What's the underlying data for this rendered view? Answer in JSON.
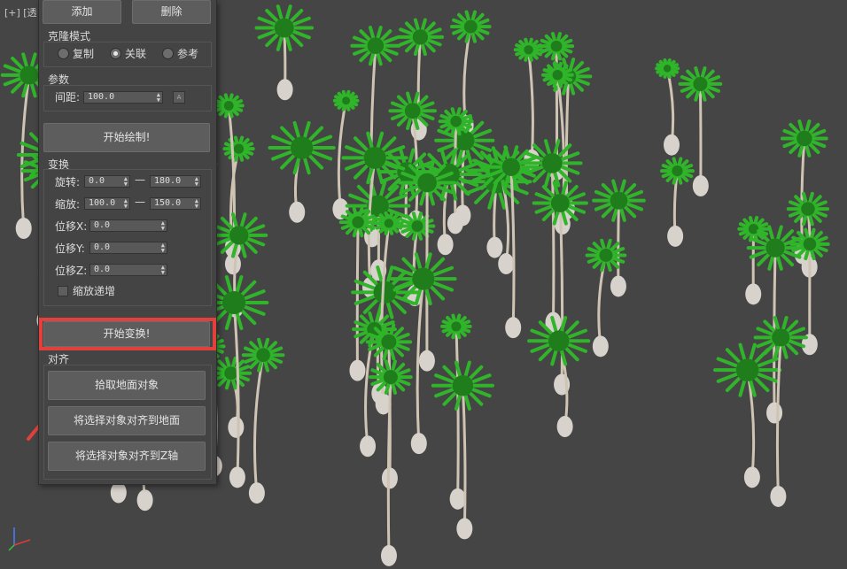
{
  "viewport": {
    "label": "[+] [透"
  },
  "panel": {
    "add_label": "添加",
    "delete_label": "删除",
    "clone_mode": {
      "title": "克隆模式",
      "options": [
        "复制",
        "关联",
        "参考"
      ],
      "selected": "关联"
    },
    "params": {
      "title": "参数",
      "spacing_label": "间距:",
      "spacing_value": "100.0",
      "lock_label": "A"
    },
    "start_paint_label": "开始绘制!",
    "transform": {
      "title": "变换",
      "rotate_label": "旋转:",
      "rotate_min": "0.0",
      "rotate_max": "180.0",
      "scale_label": "缩放:",
      "scale_min": "100.0",
      "scale_max": "150.0",
      "offset_x_label": "位移X:",
      "offset_x": "0.0",
      "offset_y_label": "位移Y:",
      "offset_y": "0.0",
      "offset_z_label": "位移Z:",
      "offset_z": "0.0",
      "scale_increment_label": "缩放递增",
      "range_separator": "—"
    },
    "start_transform_label": "开始变换!",
    "align": {
      "title": "对齐",
      "pick_ground_label": "拾取地面对象",
      "align_ground_label": "将选择对象对齐到地面",
      "align_z_label": "将选择对象对齐到Z轴"
    }
  },
  "colors": {
    "highlight": "#e2403d",
    "viewport_bg": "#454545",
    "palm_leaf": "#2fb42a",
    "trunk": "#cfc4b4"
  }
}
